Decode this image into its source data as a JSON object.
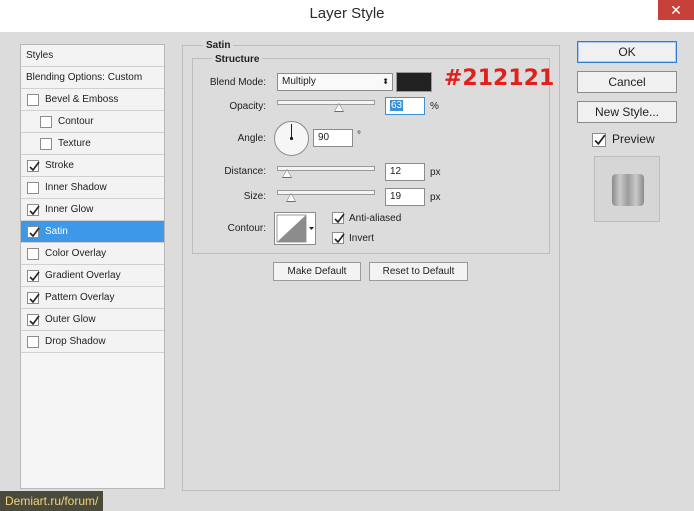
{
  "window": {
    "title": "Layer Style",
    "close_glyph": "✕"
  },
  "styles_list": {
    "items": [
      {
        "label": "Styles",
        "type": "header"
      },
      {
        "label": "Blending Options: Custom",
        "type": "header"
      },
      {
        "label": "Bevel & Emboss",
        "checked": false
      },
      {
        "label": "Contour",
        "checked": false,
        "sub": true
      },
      {
        "label": "Texture",
        "checked": false,
        "sub": true
      },
      {
        "label": "Stroke",
        "checked": true
      },
      {
        "label": "Inner Shadow",
        "checked": false
      },
      {
        "label": "Inner Glow",
        "checked": true
      },
      {
        "label": "Satin",
        "checked": true,
        "selected": true
      },
      {
        "label": "Color Overlay",
        "checked": false
      },
      {
        "label": "Gradient Overlay",
        "checked": true
      },
      {
        "label": "Pattern Overlay",
        "checked": true
      },
      {
        "label": "Outer Glow",
        "checked": true
      },
      {
        "label": "Drop Shadow",
        "checked": false
      }
    ]
  },
  "satin": {
    "section_title": "Satin",
    "structure_title": "Structure",
    "blend_mode_label": "Blend Mode:",
    "blend_mode_value": "Multiply",
    "color_hex": "#212121",
    "color_annotation": "#212121",
    "opacity_label": "Opacity:",
    "opacity_value": "63",
    "opacity_unit": "%",
    "angle_label": "Angle:",
    "angle_value": "90",
    "angle_unit": "°",
    "distance_label": "Distance:",
    "distance_value": "12",
    "distance_unit": "px",
    "size_label": "Size:",
    "size_value": "19",
    "size_unit": "px",
    "contour_label": "Contour:",
    "anti_aliased_label": "Anti-aliased",
    "anti_aliased_checked": true,
    "invert_label": "Invert",
    "invert_checked": true,
    "make_default_label": "Make Default",
    "reset_default_label": "Reset to Default"
  },
  "right_panel": {
    "ok_label": "OK",
    "cancel_label": "Cancel",
    "new_style_label": "New Style...",
    "preview_label": "Preview",
    "preview_checked": true
  },
  "watermark": {
    "text": "Demiart.ru/forum/"
  }
}
